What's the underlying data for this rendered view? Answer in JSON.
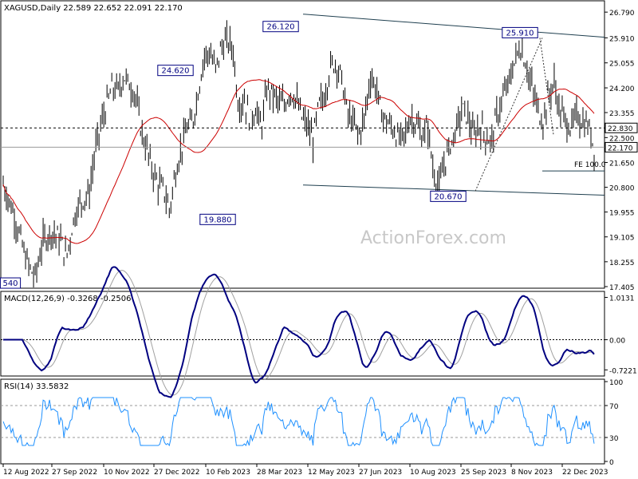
{
  "chart_data": [
    {
      "type": "candlestick",
      "symbol_header": "XAGUSD,Daily  22.589 22.652 22.091 22.170",
      "ohlc_last": {
        "open": 22.589,
        "high": 22.652,
        "low": 22.091,
        "close": 22.17
      },
      "ylim": [
        17.405,
        26.74
      ],
      "y_ticks": [
        "26.790",
        "25.910",
        "25.055",
        "24.200",
        "23.355",
        "22.500",
        "21.650",
        "20.800",
        "19.955",
        "19.105",
        "18.255",
        "17.405"
      ],
      "x_ticks": [
        "12 Aug 2022",
        "27 Sep 2022",
        "10 Nov 2022",
        "27 Dec 2022",
        "10 Feb 2023",
        "28 Mar 2023",
        "12 May 2023",
        "27 Jun 2023",
        "10 Aug 2023",
        "25 Sep 2023",
        "8 Nov 2023",
        "22 Dec 2023"
      ],
      "price_level_dashed": 22.83,
      "current_price": 22.17,
      "annotations": [
        {
          "text": "540",
          "value": 17.54
        },
        {
          "text": "24.620",
          "value": 24.62
        },
        {
          "text": "19.880",
          "value": 19.88
        },
        {
          "text": "26.120",
          "value": 26.12
        },
        {
          "text": "20.670",
          "value": 20.67
        },
        {
          "text": "25.910",
          "value": 25.91
        }
      ],
      "fe_label": "FE 100.0",
      "watermark": "ActionForex.com",
      "close_path": [
        [
          0,
          20.9
        ],
        [
          4,
          19.8
        ],
        [
          8,
          18.3
        ],
        [
          11,
          17.7
        ],
        [
          14,
          19.0
        ],
        [
          17,
          19.3
        ],
        [
          20,
          19.0
        ],
        [
          22,
          18.4
        ],
        [
          25,
          19.9
        ],
        [
          27,
          20.3
        ],
        [
          30,
          20.6
        ],
        [
          32,
          22.0
        ],
        [
          34,
          22.9
        ],
        [
          36,
          23.6
        ],
        [
          38,
          24.2
        ],
        [
          40,
          24.1
        ],
        [
          42,
          24.6
        ],
        [
          44,
          24.3
        ],
        [
          46,
          24.0
        ],
        [
          48,
          22.8
        ],
        [
          50,
          22.1
        ],
        [
          52,
          21.4
        ],
        [
          54,
          20.9
        ],
        [
          56,
          20.7
        ],
        [
          58,
          20.0
        ],
        [
          60,
          21.3
        ],
        [
          62,
          22.1
        ],
        [
          64,
          22.8
        ],
        [
          66,
          23.0
        ],
        [
          68,
          24.1
        ],
        [
          70,
          25.3
        ],
        [
          72,
          25.4
        ],
        [
          74,
          24.8
        ],
        [
          76,
          25.6
        ],
        [
          78,
          25.8
        ],
        [
          80,
          25.6
        ],
        [
          82,
          23.6
        ],
        [
          84,
          23.8
        ],
        [
          86,
          23.1
        ],
        [
          88,
          23.5
        ],
        [
          90,
          22.8
        ],
        [
          92,
          24.2
        ],
        [
          94,
          24.0
        ],
        [
          96,
          23.7
        ],
        [
          98,
          23.6
        ],
        [
          100,
          24.1
        ],
        [
          102,
          23.8
        ],
        [
          104,
          23.2
        ],
        [
          106,
          22.9
        ],
        [
          108,
          22.4
        ],
        [
          110,
          23.6
        ],
        [
          112,
          23.9
        ],
        [
          114,
          24.9
        ],
        [
          116,
          25.1
        ],
        [
          118,
          24.5
        ],
        [
          120,
          23.3
        ],
        [
          122,
          23.0
        ],
        [
          124,
          22.6
        ],
        [
          126,
          23.2
        ],
        [
          128,
          24.6
        ],
        [
          130,
          24.2
        ],
        [
          132,
          23.3
        ],
        [
          134,
          23.0
        ],
        [
          136,
          22.8
        ],
        [
          138,
          22.4
        ],
        [
          140,
          22.6
        ],
        [
          142,
          23.2
        ],
        [
          144,
          23.0
        ],
        [
          146,
          22.5
        ],
        [
          148,
          22.9
        ],
        [
          150,
          21.3
        ],
        [
          152,
          20.8
        ],
        [
          154,
          21.7
        ],
        [
          156,
          22.3
        ],
        [
          158,
          22.8
        ],
        [
          160,
          23.5
        ],
        [
          162,
          23.2
        ],
        [
          164,
          22.5
        ],
        [
          166,
          22.9
        ],
        [
          168,
          22.6
        ],
        [
          170,
          22.3
        ],
        [
          172,
          23.2
        ],
        [
          174,
          23.8
        ],
        [
          176,
          24.3
        ],
        [
          178,
          25.0
        ],
        [
          180,
          25.6
        ],
        [
          182,
          25.1
        ],
        [
          184,
          24.3
        ],
        [
          186,
          23.6
        ],
        [
          188,
          23.0
        ],
        [
          190,
          23.9
        ],
        [
          192,
          24.4
        ],
        [
          194,
          23.4
        ],
        [
          196,
          23.1
        ],
        [
          198,
          22.8
        ],
        [
          200,
          23.3
        ],
        [
          202,
          23.0
        ],
        [
          204,
          22.9
        ],
        [
          206,
          22.17
        ]
      ]
    },
    {
      "type": "line",
      "title": "MACD(12,26,9) -0.3268 -0.2506",
      "ylim": [
        -0.85,
        1.1
      ],
      "y_ticks": [
        "1.0131",
        "0.00",
        "-0.7221"
      ],
      "zero_line": 0.0
    },
    {
      "type": "line",
      "title": "RSI(14) 33.5832",
      "ylim": [
        0,
        100
      ],
      "y_ticks": [
        "100",
        "70",
        "30",
        "0"
      ],
      "levels": [
        70,
        30
      ]
    }
  ],
  "colors": {
    "price": "#000000",
    "ma": "#cc0000",
    "label_text": "#000080",
    "macd": "#000080",
    "signal": "#a0a0a0",
    "rsi": "#1e90ff",
    "trendline": "#1f3f4f",
    "watermark": "#c8c8c8"
  }
}
